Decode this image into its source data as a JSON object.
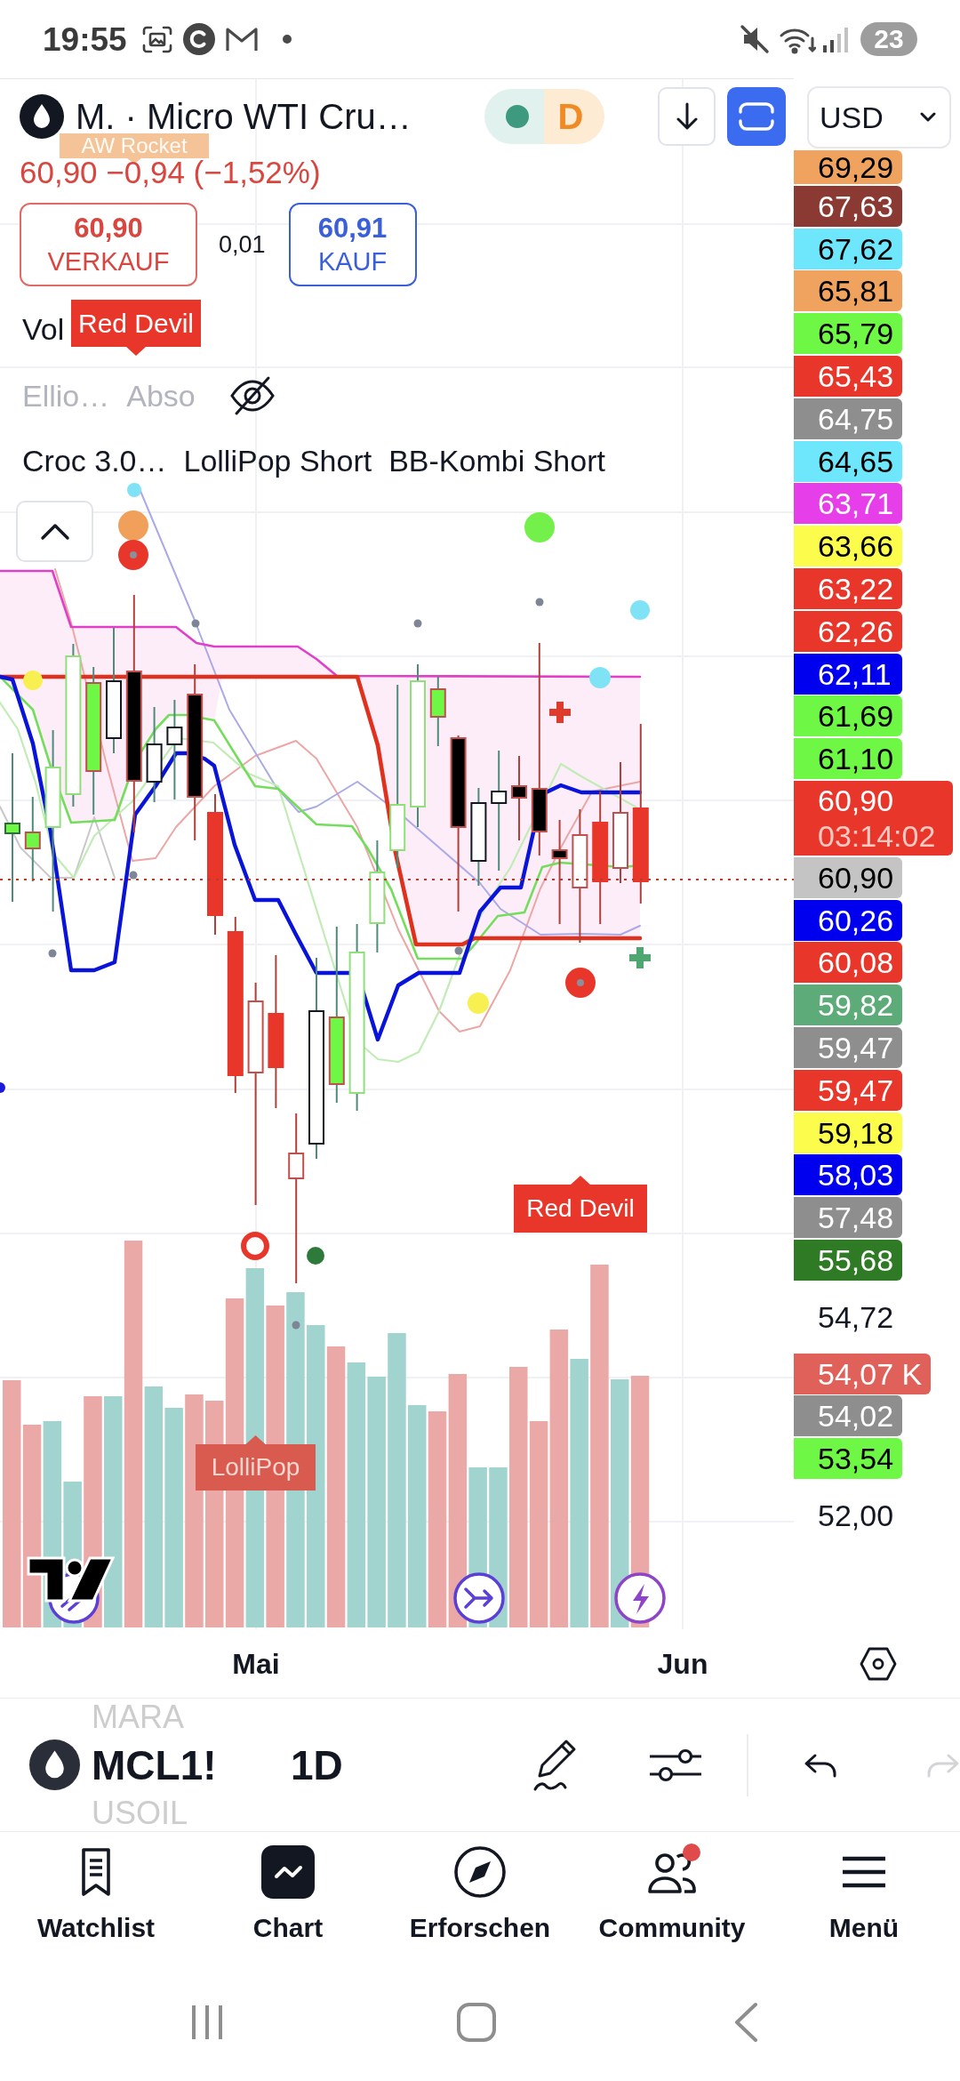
{
  "status_bar": {
    "time": "19:55",
    "battery": "23"
  },
  "header": {
    "title": "M. · Micro WTI Cru…",
    "delay_badge": "D",
    "currency": "USD"
  },
  "quote": {
    "change": "60,90 −0,94 (−1,52%)",
    "sell_price": "60,90",
    "sell_label": "VERKAUF",
    "spread": "0,01",
    "buy_price": "60,91",
    "buy_label": "KAUF"
  },
  "legend": [
    {
      "labels": [
        "Vol"
      ],
      "hidden": false
    },
    {
      "labels": [
        "Ellio…",
        "Abso"
      ],
      "hidden": true
    },
    {
      "labels": [
        "Croc 3.0…",
        "LolliPop Short",
        "BB-Kombi Short"
      ],
      "hidden": false
    }
  ],
  "chart": {
    "tags": [
      {
        "text": "AW Rocket",
        "color": "#f5c398"
      },
      {
        "text": "Red Devil",
        "color": "#e8372a"
      },
      {
        "text": "Red Devil",
        "color": "#e8372a"
      },
      {
        "text": "LolliPop",
        "color": "#d95a4f"
      }
    ]
  },
  "price_scale": [
    {
      "text": "69,29",
      "kind": "tag",
      "color": "#f0a35e"
    },
    {
      "text": "67,63",
      "kind": "tag",
      "color": "#8b3a33"
    },
    {
      "text": "67,62",
      "kind": "tag",
      "color": "#6ee6fb"
    },
    {
      "text": "65,81",
      "kind": "tag",
      "color": "#f0a35e"
    },
    {
      "text": "65,79",
      "kind": "tag",
      "color": "#6ff746"
    },
    {
      "text": "65,43",
      "kind": "tag",
      "color": "#e8372a"
    },
    {
      "text": "64,75",
      "kind": "tag",
      "color": "#8e8e8e"
    },
    {
      "text": "64,65",
      "kind": "tag",
      "color": "#6ee6fb"
    },
    {
      "text": "63,71",
      "kind": "tag",
      "color": "#e63ee9"
    },
    {
      "text": "63,66",
      "kind": "tag",
      "color": "#fcfc4c"
    },
    {
      "text": "63,22",
      "kind": "tag",
      "color": "#e8372a"
    },
    {
      "text": "62,26",
      "kind": "tag",
      "color": "#e8372a"
    },
    {
      "text": "62,11",
      "kind": "tag",
      "color": "#0000ee"
    },
    {
      "text": "61,69",
      "kind": "tag",
      "color": "#6ff746"
    },
    {
      "text": "61,10",
      "kind": "tag",
      "color": "#6ff746"
    },
    {
      "text": "60,90",
      "countdown": "03:14:02",
      "kind": "current",
      "color": "#e8372a"
    },
    {
      "text": "60,90",
      "kind": "tag",
      "color": "#c4c4c4"
    },
    {
      "text": "60,26",
      "kind": "tag",
      "color": "#0000ee"
    },
    {
      "text": "60,08",
      "kind": "tag",
      "color": "#e8372a"
    },
    {
      "text": "59,82",
      "kind": "tag",
      "color": "#5cab78"
    },
    {
      "text": "59,47",
      "kind": "tag",
      "color": "#8e8e8e"
    },
    {
      "text": "59,47",
      "kind": "tag",
      "color": "#e8372a"
    },
    {
      "text": "59,18",
      "kind": "tag",
      "color": "#fcfc4c"
    },
    {
      "text": "58,03",
      "kind": "tag",
      "color": "#0000ee"
    },
    {
      "text": "57,48",
      "kind": "tag",
      "color": "#8e8e8e"
    },
    {
      "text": "55,68",
      "kind": "tag",
      "color": "#2f7a24"
    },
    {
      "text": "54,72",
      "kind": "tick"
    },
    {
      "text": "54,07 K",
      "kind": "tag",
      "color": "#e0605a"
    },
    {
      "text": "54,02",
      "kind": "tag",
      "color": "#8e8e8e"
    },
    {
      "text": "53,54",
      "kind": "tag",
      "color": "#6ff746"
    },
    {
      "text": "52,00",
      "kind": "tick"
    }
  ],
  "time_axis": [
    "Mai",
    "Jun"
  ],
  "toolbar": {
    "picker_above": "MARA",
    "symbol": "MCL1!",
    "picker_below": "USOIL",
    "interval": "1D",
    "history": [
      {
        "kind": "undo",
        "disabled": false
      },
      {
        "kind": "redo",
        "disabled": true
      }
    ]
  },
  "nav": [
    {
      "label": "Watchlist",
      "selected": false,
      "notification": false
    },
    {
      "label": "Chart",
      "selected": true,
      "notification": false
    },
    {
      "label": "Erforschen",
      "selected": false,
      "notification": false
    },
    {
      "label": "Community",
      "selected": false,
      "notification": true
    },
    {
      "label": "Menü",
      "selected": false,
      "notification": false
    }
  ]
}
